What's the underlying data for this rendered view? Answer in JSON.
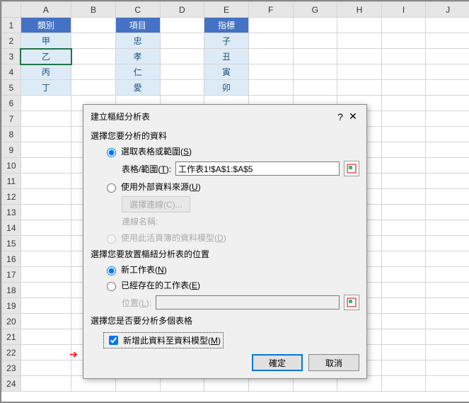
{
  "cols": [
    "A",
    "B",
    "C",
    "D",
    "E",
    "F",
    "G",
    "H",
    "I",
    "J"
  ],
  "rows": [
    "1",
    "2",
    "3",
    "4",
    "5",
    "6",
    "7",
    "8",
    "9",
    "10",
    "11",
    "12",
    "13",
    "14",
    "15",
    "16",
    "17",
    "18",
    "19",
    "20",
    "21",
    "22",
    "23",
    "24"
  ],
  "data": {
    "A1": "類別",
    "C1": "項目",
    "E1": "指標",
    "A2": "甲",
    "C2": "忠",
    "E2": "子",
    "A3": "乙",
    "C3": "孝",
    "E3": "丑",
    "A4": "丙",
    "C4": "仁",
    "E4": "寅",
    "A5": "丁",
    "C5": "愛",
    "E5": "卯"
  },
  "dialog": {
    "title": "建立樞紐分析表",
    "help": "?",
    "close": "✕",
    "section1": "選擇您要分析的資料",
    "opt_select": "選取表格或範圍",
    "opt_select_hk": "S",
    "range_label": "表格/範圍",
    "range_hk": "T",
    "range_value": "工作表1!$A$1:$A$5",
    "opt_external": "使用外部資料來源",
    "opt_external_hk": "U",
    "choose_conn": "選擇連線",
    "choose_conn_hk": "C",
    "conn_name": "連線名稱:",
    "opt_model": "使用此活頁簿的資料模型",
    "opt_model_hk": "D",
    "section2": "選擇您要放置樞紐分析表的位置",
    "opt_new": "新工作表",
    "opt_new_hk": "N",
    "opt_exist": "已經存在的工作表",
    "opt_exist_hk": "E",
    "loc_label": "位置",
    "loc_hk": "L",
    "loc_value": "",
    "section3": "選擇您是否要分析多個表格",
    "add_model": "新增此資料至資料模型",
    "add_model_hk": "M",
    "ok": "確定",
    "cancel": "取消"
  }
}
